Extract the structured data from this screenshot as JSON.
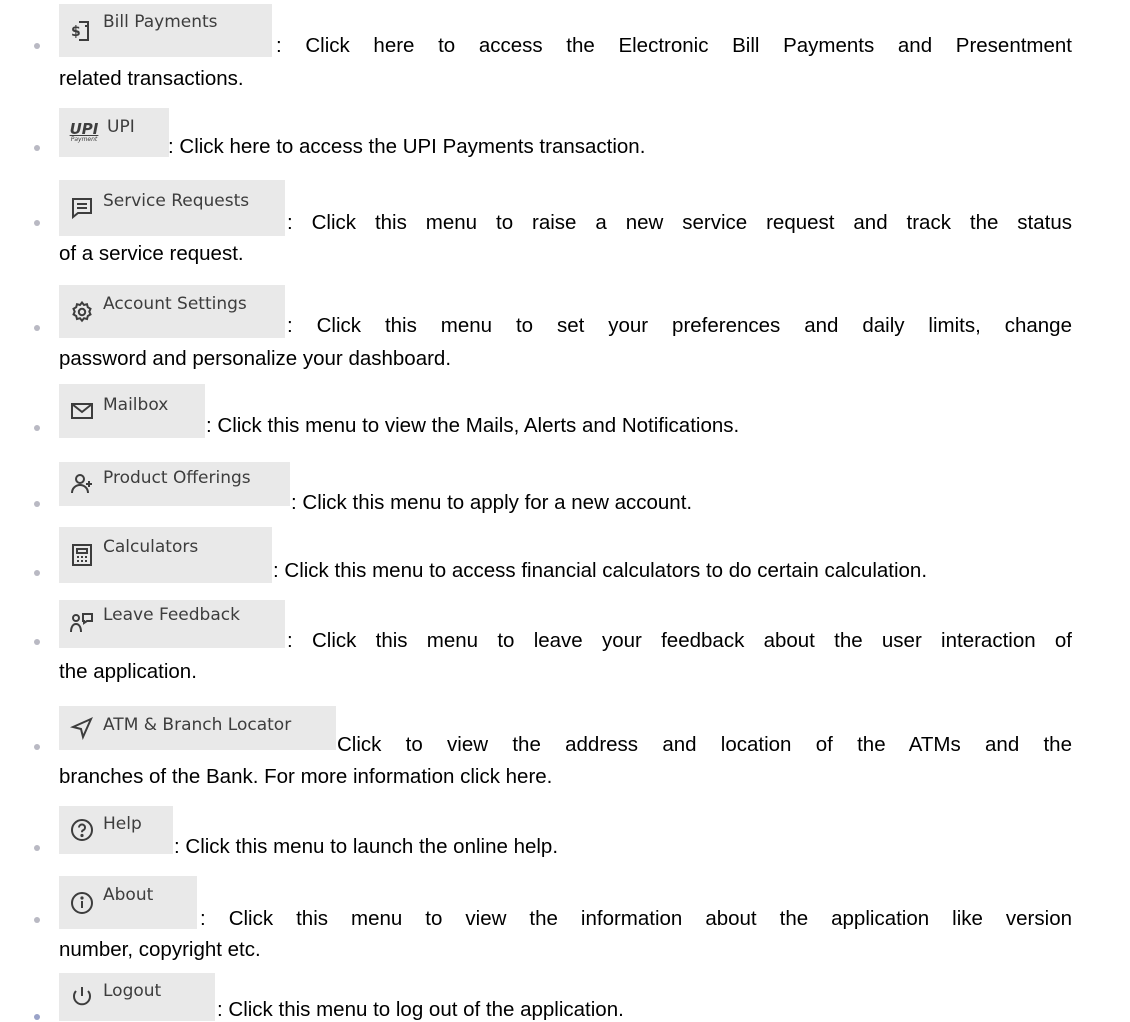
{
  "items": [
    {
      "label": "Bill Payments",
      "icon": "bill-payments-icon",
      "desc": ": Click here to access the Electronic Bill Payments and Presentment",
      "cont": "related transactions."
    },
    {
      "label": "UPI",
      "icon": "upi-icon",
      "icon_text": "UPI",
      "icon_sub": "Payment",
      "desc": ": Click here to access the UPI Payments transaction.",
      "cont": ""
    },
    {
      "label": "Service Requests",
      "icon": "service-request-icon",
      "desc": ": Click this menu to raise a new service request and track the status",
      "cont": "of a service request."
    },
    {
      "label": "Account Settings",
      "icon": "gear-icon",
      "desc": ": Click this menu to set your preferences and daily limits, change",
      "cont": "password and personalize your dashboard."
    },
    {
      "label": "Mailbox",
      "icon": "mail-icon",
      "desc": ": Click this menu to view the Mails, Alerts and Notifications.",
      "cont": ""
    },
    {
      "label": "Product Offerings",
      "icon": "add-user-icon",
      "desc": ": Click this menu to apply for a new account.",
      "cont": ""
    },
    {
      "label": "Calculators",
      "icon": "calculator-icon",
      "desc": ": Click this menu to access financial calculators to do certain calculation.",
      "cont": ""
    },
    {
      "label": "Leave Feedback",
      "icon": "feedback-icon",
      "desc": ": Click this menu to leave your feedback about the user interaction of",
      "cont": "the application."
    },
    {
      "label": "ATM & Branch Locator",
      "icon": "location-arrow-icon",
      "desc": "Click to view the address and location of the ATMs and the",
      "cont": "branches of the Bank. For more information click here."
    },
    {
      "label": "Help",
      "icon": "help-icon",
      "desc": ": Click this menu to launch the online help.",
      "cont": ""
    },
    {
      "label": "About",
      "icon": "info-icon",
      "desc": ": Click this menu to view the information about the application like version",
      "cont": "number, copyright etc."
    },
    {
      "label": "Logout",
      "icon": "power-icon",
      "desc": ": Click this menu to log out of the application.",
      "cont": ""
    }
  ]
}
